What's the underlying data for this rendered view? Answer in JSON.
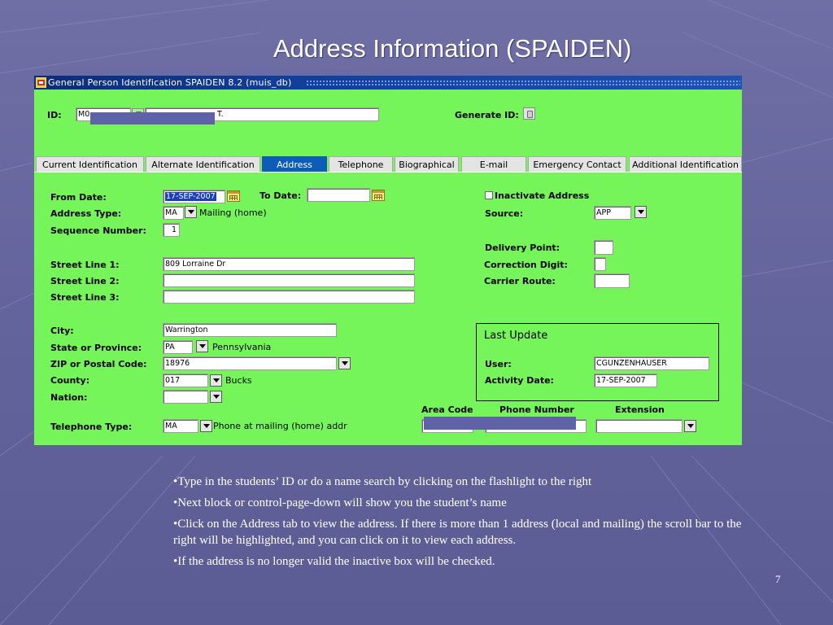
{
  "slide": {
    "title": "Address Information (SPAIDEN)",
    "page_number": "7",
    "notes": [
      "•Type in the students’ ID or do a name search by clicking on the flashlight to the right",
      "•Next block or control-page-down will show you the student’s name",
      "•Click on the Address tab to view the address.  If there is more than 1 address (local and mailing) the scroll bar to the right will be highlighted, and you can click on it to view each address.",
      "•If the address is no longer valid the inactive box will be checked."
    ]
  },
  "window": {
    "title": "General Person Identification  SPAIDEN  8.2  (muis_db)",
    "icon": "banner-app-icon"
  },
  "key_block": {
    "id_label": "ID:",
    "id_value": "M0",
    "name_value": "T.",
    "generate_id_label": "Generate ID:",
    "generate_icon": "flashlight-icon"
  },
  "tabs": [
    {
      "label": "Current Identification",
      "active": false
    },
    {
      "label": "Alternate Identification",
      "active": false
    },
    {
      "label": "Address",
      "active": true
    },
    {
      "label": "Telephone",
      "active": false
    },
    {
      "label": "Biographical",
      "active": false
    },
    {
      "label": "E-mail",
      "active": false
    },
    {
      "label": "Emergency Contact",
      "active": false
    },
    {
      "label": "Additional Identification",
      "active": false
    }
  ],
  "address": {
    "from_date_label": "From Date:",
    "from_date": "17-SEP-2007",
    "to_date_label": "To Date:",
    "to_date": "",
    "inactivate_label": "Inactivate Address",
    "inactivate_checked": false,
    "address_type_label": "Address Type:",
    "address_type": "MA",
    "address_type_desc": "Mailing (home)",
    "source_label": "Source:",
    "source": "APP",
    "sequence_label": "Sequence Number:",
    "sequence": "1",
    "delivery_point_label": "Delivery Point:",
    "delivery_point": "",
    "correction_digit_label": "Correction Digit:",
    "correction_digit": "",
    "carrier_route_label": "Carrier Route:",
    "carrier_route": "",
    "street1_label": "Street Line 1:",
    "street1": "809 Lorraine Dr",
    "street2_label": "Street Line 2:",
    "street2": "",
    "street3_label": "Street Line 3:",
    "street3": "",
    "city_label": "City:",
    "city": "Warrington",
    "state_label": "State or Province:",
    "state": "PA",
    "state_desc": "Pennsylvania",
    "zip_label": "ZIP or Postal Code:",
    "zip": "18976",
    "county_label": "County:",
    "county": "017",
    "county_desc": "Bucks",
    "nation_label": "Nation:",
    "nation": "",
    "telephone_type_label": "Telephone Type:",
    "telephone_type": "MA",
    "telephone_type_desc": "Phone at mailing (home) addr",
    "area_code_label": "Area Code",
    "phone_number_label": "Phone Number",
    "extension_label": "Extension",
    "extension": ""
  },
  "last_update": {
    "title": "Last Update",
    "user_label": "User:",
    "user": "CGUNZENHAUSER",
    "activity_date_label": "Activity Date:",
    "activity_date": "17-SEP-2007"
  },
  "colors": {
    "form_background": "#76f55a",
    "active_tab": "#0e5bb8",
    "slide_background": "#6666a0",
    "redaction": "#5f62a6"
  }
}
